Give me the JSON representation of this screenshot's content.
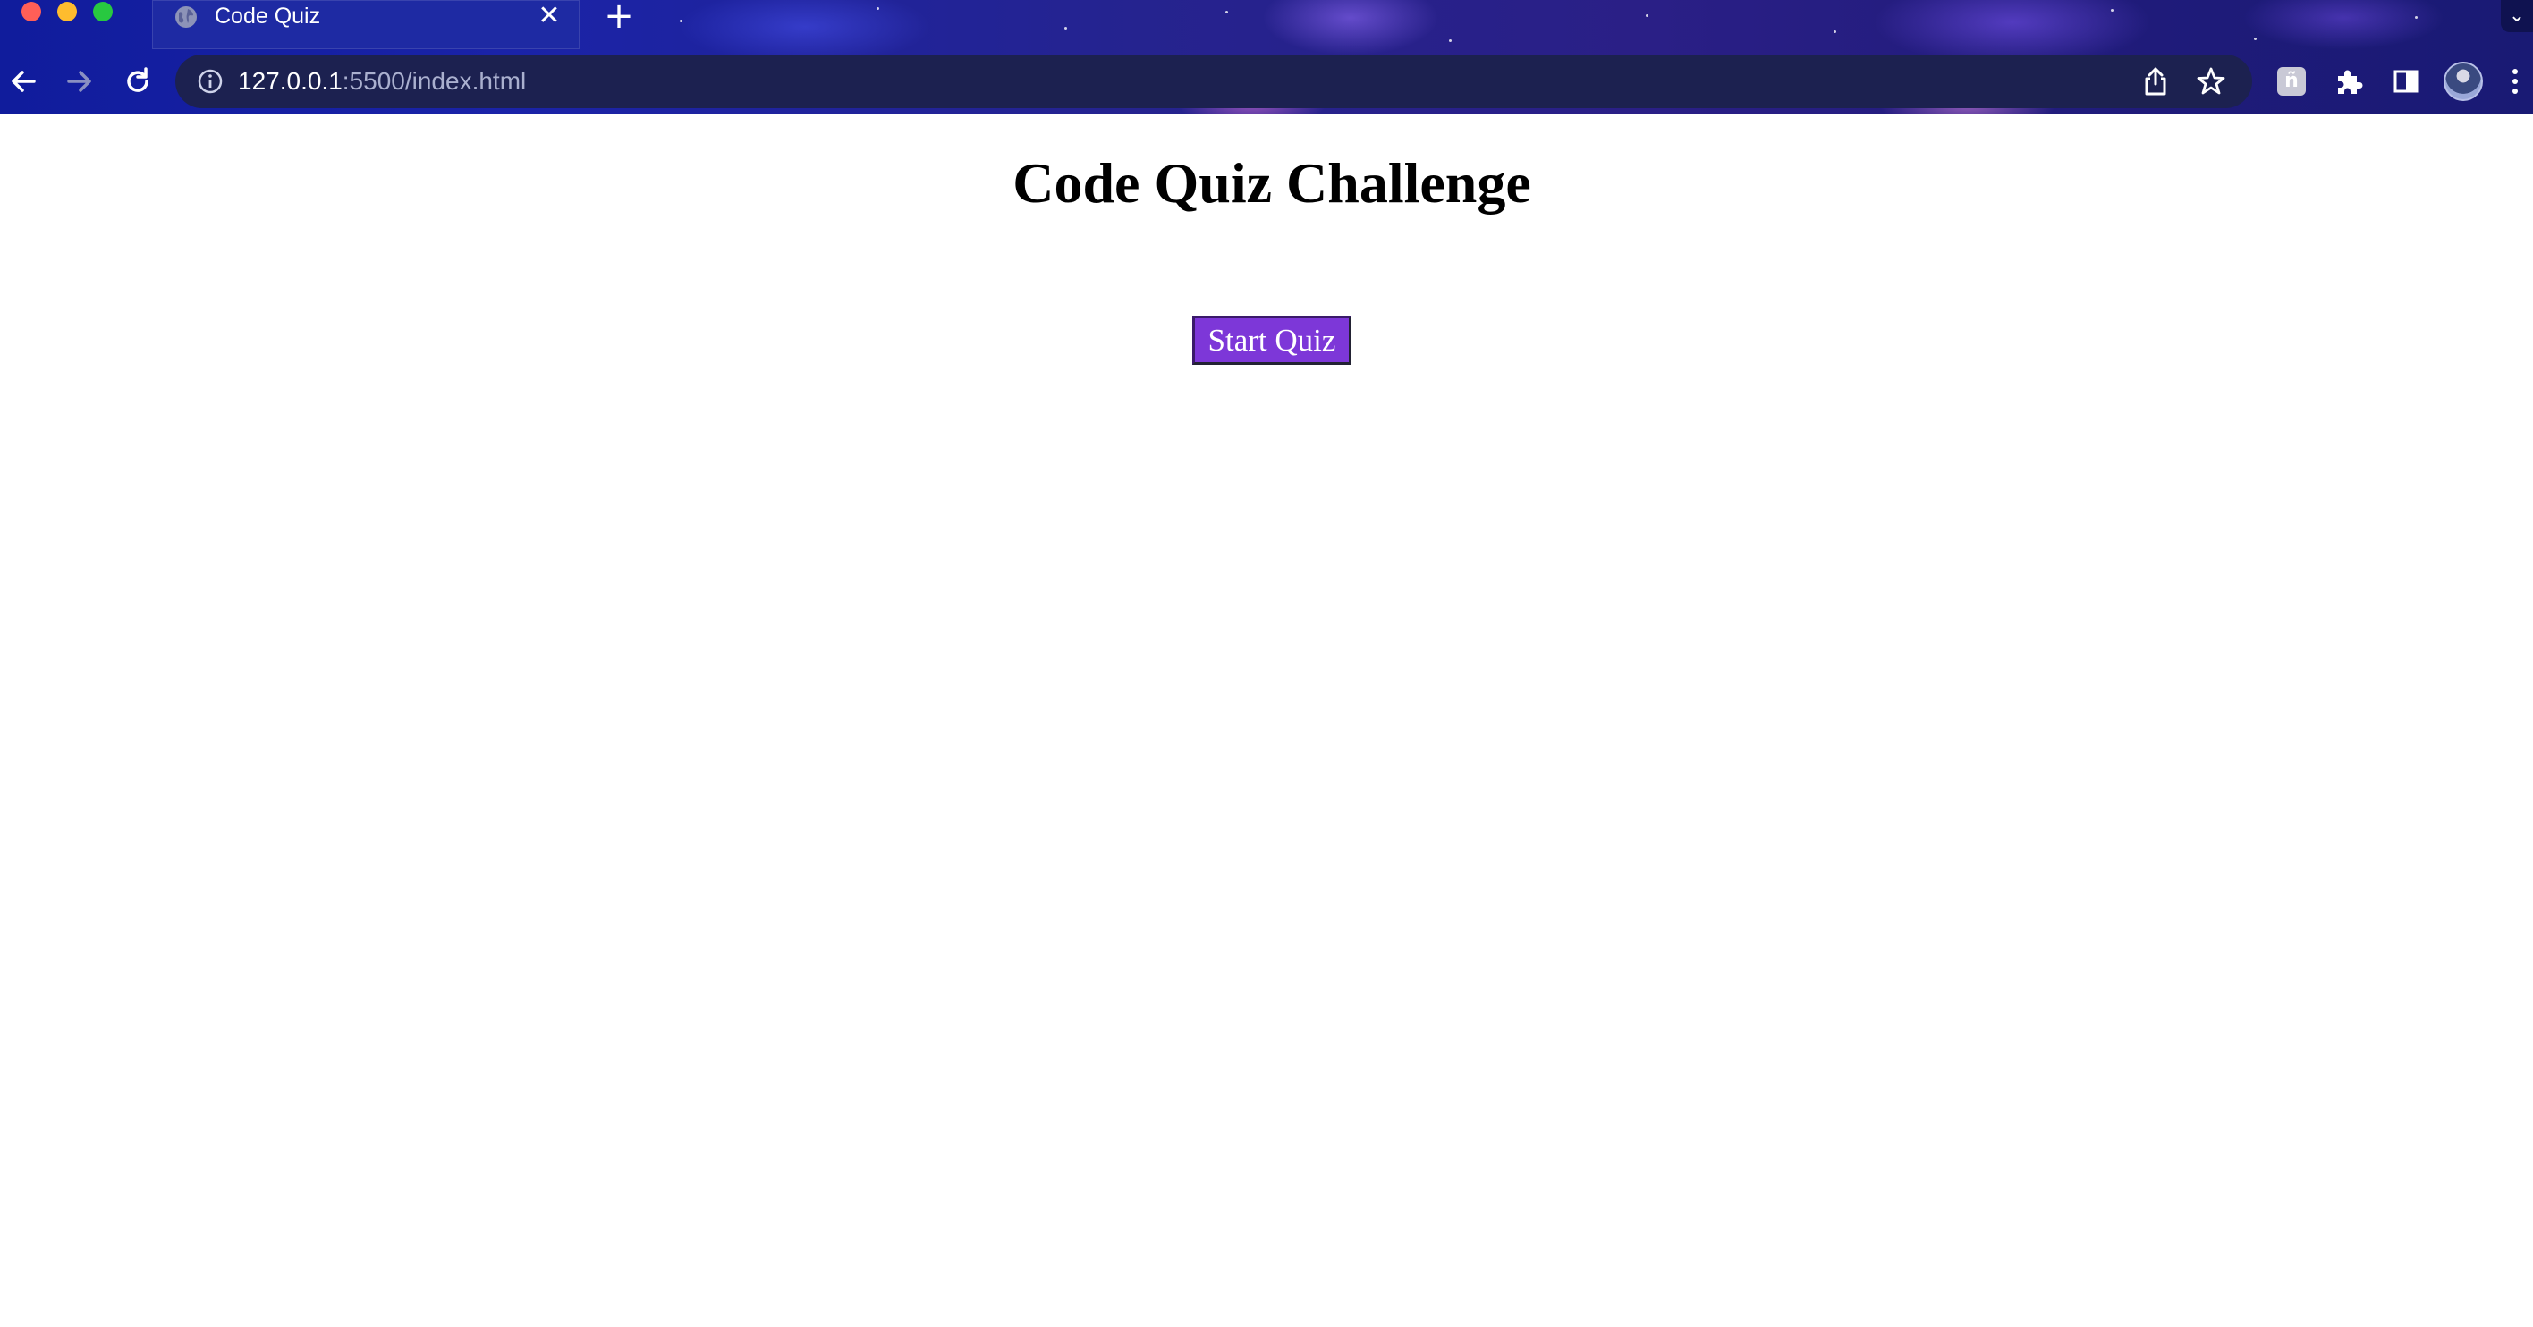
{
  "browser": {
    "tab": {
      "title": "Code Quiz",
      "favicon": "globe-icon",
      "close_symbol": "✕"
    },
    "new_tab_symbol": "+",
    "tab_menu_symbol": "⌄",
    "address_bar": {
      "host": "127.0.0.1",
      "path": ":5500/index.html",
      "info_icon": "info-icon"
    },
    "toolbar_icons": [
      "back-arrow-icon",
      "forward-arrow-icon",
      "reload-icon",
      "share-icon",
      "bookmark-star-icon",
      "extension-icon",
      "puzzle-icon",
      "side-panel-icon",
      "profile-avatar",
      "more-menu-icon"
    ],
    "extension_badge_letter": "ñ"
  },
  "page": {
    "title": "Code Quiz Challenge",
    "start_button_label": "Start Quiz"
  },
  "colors": {
    "start_button": "#7d37d8",
    "chrome_background": "#1a23a8",
    "omnibox_background": "#1c2150"
  }
}
